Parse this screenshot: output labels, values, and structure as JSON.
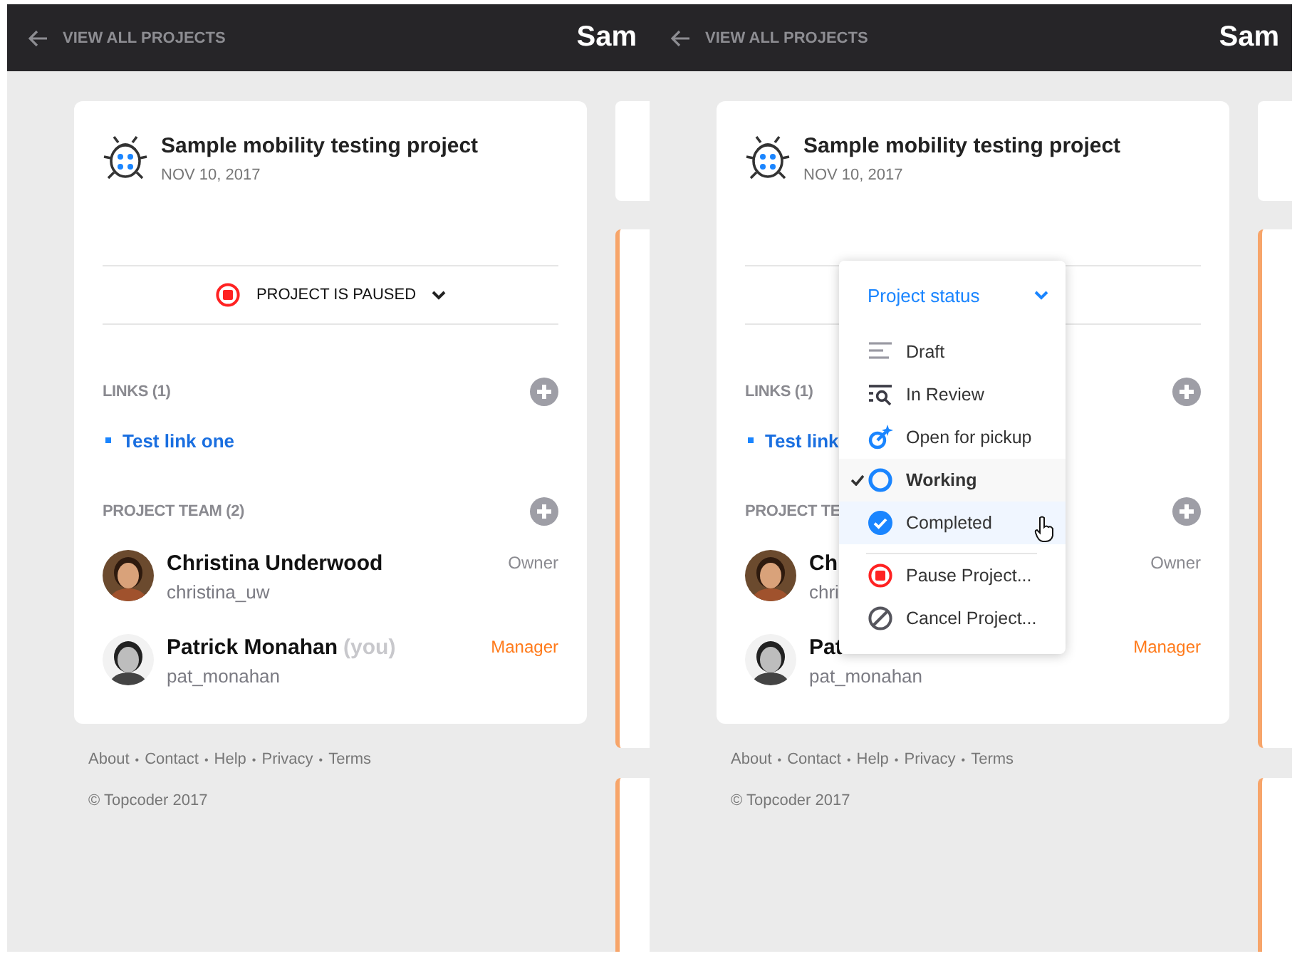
{
  "panels": [
    {
      "header": {
        "back_label": "VIEW ALL PROJECTS",
        "title": "Sam"
      },
      "project": {
        "name": "Sample mobility testing project",
        "date": "NOV 10, 2017"
      },
      "status": {
        "label": "PROJECT IS PAUSED"
      },
      "links": {
        "title": "LINKS (1)",
        "items": [
          "Test link one"
        ]
      },
      "team": {
        "title": "PROJECT TEAM (2)",
        "members": [
          {
            "name": "Christina Underwood",
            "handle": "christina_uw",
            "role": "Owner",
            "color": "#8a8a90"
          },
          {
            "name": "Patrick Monahan",
            "you_label": "(you)",
            "handle": "pat_monahan",
            "role": "Manager",
            "color": "#ff7a1a"
          }
        ]
      },
      "footer": {
        "links": [
          "About",
          "Contact",
          "Help",
          "Privacy",
          "Terms"
        ],
        "separator": "•",
        "copyright": "© Topcoder 2017"
      },
      "side_cards": [
        {
          "accent": false
        },
        {
          "accent": true
        },
        {
          "accent": true
        }
      ]
    },
    {
      "header": {
        "back_label": "VIEW ALL PROJECTS",
        "title": "Sam"
      },
      "project": {
        "name": "Sample mobility testing project",
        "date": "NOV 10, 2017"
      },
      "links": {
        "title": "LINKS (1)",
        "items": [
          "Test link"
        ]
      },
      "team": {
        "title": "PROJECT TE",
        "members": [
          {
            "name": "Ch",
            "handle": "chri",
            "role": "Owner",
            "color": "#8a8a90"
          },
          {
            "name": "Pat",
            "handle": "pat_monahan",
            "role": "Manager",
            "color": "#ff7a1a"
          }
        ]
      },
      "status_menu": {
        "title": "Project status",
        "items": [
          {
            "label": "Draft",
            "kind": "draft",
            "selected": false,
            "hovered": false
          },
          {
            "label": "In Review",
            "kind": "review",
            "selected": false,
            "hovered": false
          },
          {
            "label": "Open for pickup",
            "kind": "pickup",
            "selected": false,
            "hovered": false
          },
          {
            "label": "Working",
            "kind": "working",
            "selected": true,
            "hovered": false
          },
          {
            "label": "Completed",
            "kind": "completed",
            "selected": false,
            "hovered": true
          },
          {
            "label": "Pause Project...",
            "kind": "pause",
            "selected": false,
            "hovered": false
          },
          {
            "label": "Cancel Project...",
            "kind": "cancel",
            "selected": false,
            "hovered": false
          }
        ]
      },
      "footer": {
        "links": [
          "About",
          "Contact",
          "Help",
          "Privacy",
          "Terms"
        ],
        "separator": "•",
        "copyright": "© Topcoder 2017"
      },
      "side_cards": [
        {
          "accent": false
        },
        {
          "accent": true
        },
        {
          "accent": true
        }
      ]
    }
  ]
}
